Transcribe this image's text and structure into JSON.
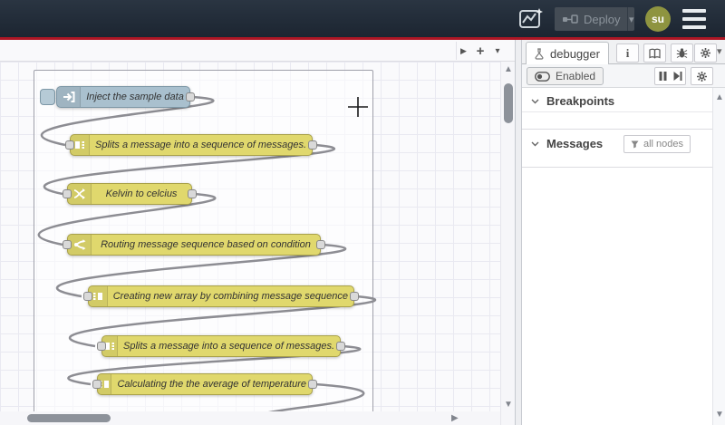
{
  "header": {
    "deploy": {
      "label": "Deploy"
    },
    "avatar": {
      "initials": "su"
    }
  },
  "glyphs": {
    "info": "i",
    "caret_down": "▾",
    "plus": "+",
    "scroll_up": "▲",
    "scroll_down": "▼",
    "scroll_right": "▶",
    "tab_scroll_right": "▶"
  },
  "canvas": {
    "nodes": [
      {
        "type": "inject",
        "label": "Inject the sample data",
        "color": "#a9c0ce"
      },
      {
        "type": "split",
        "label": "Splits a message into a sequence of messages.",
        "color": "#e0d86d"
      },
      {
        "type": "change",
        "label": "Kelvin to celcius",
        "color": "#e0d86d"
      },
      {
        "type": "switch",
        "label": "Routing message sequence based on condition",
        "color": "#e0d86d"
      },
      {
        "type": "join",
        "label": "Creating new array by combining message sequence",
        "color": "#e0d86d"
      },
      {
        "type": "split",
        "label": "Splits a message into a sequence of messages.",
        "color": "#e0d86d"
      },
      {
        "type": "join",
        "label": "Calculating the the average of temperature",
        "color": "#e0d86d"
      }
    ]
  },
  "sidebar": {
    "active_tab": {
      "label": "debugger"
    },
    "toolbar": {
      "enabled_label": "Enabled"
    },
    "sections": {
      "breakpoints": {
        "title": "Breakpoints"
      },
      "messages": {
        "title": "Messages",
        "filter_label": "all nodes"
      }
    }
  },
  "colors": {
    "header_bg": "#222d39",
    "accent_red": "#ad1625",
    "node_yellow": "#e0d86d",
    "node_inject": "#a9c0ce",
    "node_border_yellow": "#a9a14a",
    "wire": "#8d8d93",
    "avatar_bg": "#8e9440",
    "canvas_grid": "#e9e9f1"
  }
}
